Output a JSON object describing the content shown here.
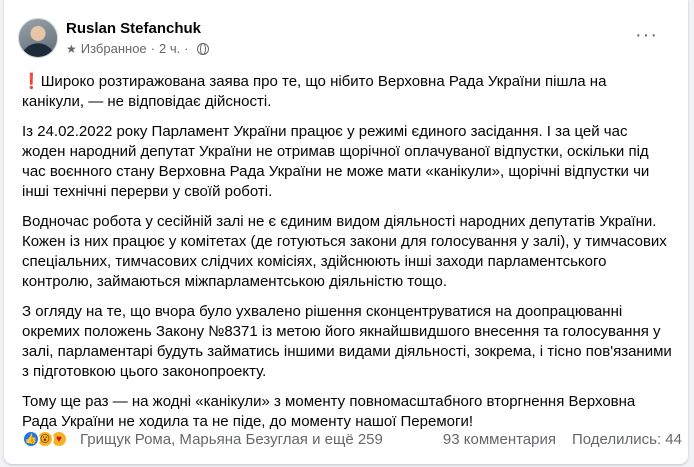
{
  "post": {
    "author": "Ruslan Stefanchuk",
    "audience_label": "Избранное",
    "time": "2 ч.",
    "separator": "·",
    "paragraphs": [
      "Широко розтиражована заява про те, що нібито Верховна Рада України пішла на канікули, — не відповідає дійсності.",
      "Із 24.02.2022 року Парламент України працює у режимі єдиного засідання. І за цей час жоден народний депутат України не отримав щорічної оплачуваної відпустки, оскільки під час воєнного стану Верховна Рада України не може мати «канікули», щорічні відпустки чи інші технічні перерви у своїй роботі.",
      "Водночас робота у сесійній залі не є єдиним видом діяльності народних депутатів України. Кожен із них працює у комітетах (де готуються закони для голосування у залі), у тимчасових спеціальних, тимчасових слідчих комісіях, здійснюють інші заходи парламентського контролю, займаються міжпарламентською діяльністю тощо.",
      "З огляду на те, що вчора було ухвалено рішення сконцентруватися на доопрацюванні окремих положень Закону №8371 із метою його якнайшвидшого внесення та голосування у залі, парламентарі будуть займатись іншими видами діяльності, зокрема, і тісно пов'язаними з підготовкою цього законопроекту.",
      "Тому ще раз — на жодні «канікули» з моменту повномасштабного вторгнення Верховна Рада України не ходила та не піде, до моменту нашої Перемоги!"
    ],
    "exclamation": "❗"
  },
  "footer": {
    "reactors": "Грищук Рома, Марьяна Безуглая и ещё 259",
    "comments": "93 комментария",
    "shares": "Поделились: 44"
  },
  "icons": {
    "star": "★",
    "more": "···",
    "like": "👍",
    "wow": "😮",
    "care": "♥"
  },
  "colors": {
    "accent": "#1877f2",
    "secondary_text": "#65676b",
    "alert": "#e4322b"
  }
}
